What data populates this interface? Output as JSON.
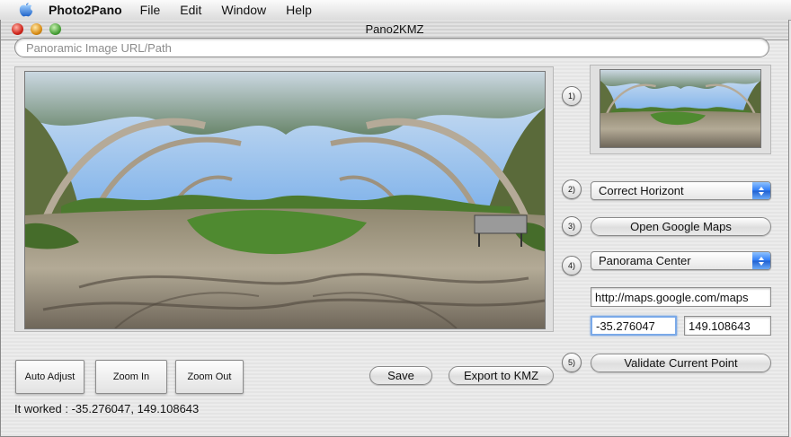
{
  "menubar": {
    "app_name": "Photo2Pano",
    "items": [
      "File",
      "Edit",
      "Window",
      "Help"
    ]
  },
  "window": {
    "title": "Pano2KMZ"
  },
  "url_field": {
    "placeholder": "Panoramic Image URL/Path",
    "value": ""
  },
  "steps": [
    "1)",
    "2)",
    "3)",
    "4)",
    "5)"
  ],
  "horizon_popup": {
    "selected": "Correct Horizont"
  },
  "google_maps_button": {
    "label": "Open Google Maps"
  },
  "point_popup": {
    "selected": "Panorama Center"
  },
  "maps_url_field": {
    "value": "http://maps.google.com/maps"
  },
  "latitude_field": {
    "value": "-35.276047"
  },
  "longitude_field": {
    "value": "149.108643"
  },
  "validate_button": {
    "label": "Validate Current Point"
  },
  "buttons": {
    "auto_adjust": "Auto Adjust",
    "zoom_in": "Zoom In",
    "zoom_out": "Zoom Out",
    "save": "Save",
    "export": "Export to KMZ"
  },
  "status": {
    "text": "It worked : -35.276047, 149.108643"
  },
  "icons": {
    "apple": "apple-logo-icon",
    "popup_arrows": "updown-arrows-icon"
  },
  "colors": {
    "accent": "#2e7cf6",
    "focus_ring": "#7aa9e8",
    "sky": "#4b8fdc",
    "foliage": "#3e6a28",
    "path": "#9a8f7c"
  }
}
